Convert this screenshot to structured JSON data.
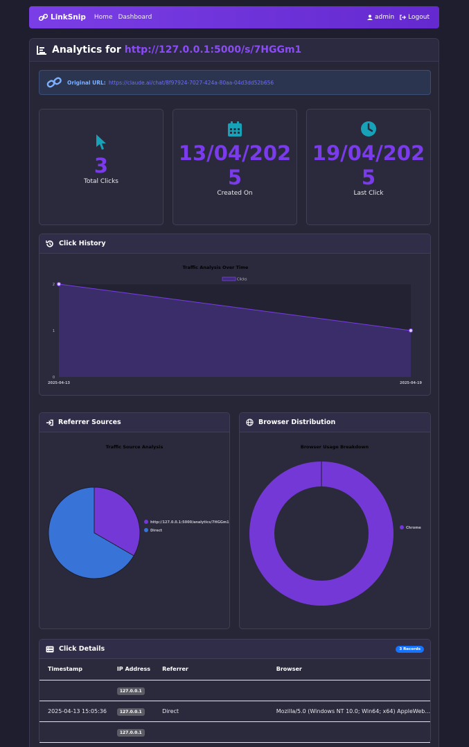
{
  "nav": {
    "brand": "LinkSnip",
    "links": [
      "Home",
      "Dashboard"
    ],
    "user": "admin",
    "logout": "Logout"
  },
  "header": {
    "prefix": "Analytics for",
    "short_url": "http://127.0.0.1:5000/s/7HGGm1"
  },
  "alert": {
    "label": "Original URL:",
    "url": "https://claude.ai/chat/8f97924-7027-424a-80aa-04d3dd52b656"
  },
  "stats": {
    "total_clicks": "3",
    "total_clicks_label": "Total Clicks",
    "created_line1": "13/04/202",
    "created_line2": "5",
    "created_label": "Created On",
    "last_line1": "19/04/202",
    "last_line2": "5",
    "last_label": "Last Click"
  },
  "click_history": {
    "title": "Click History",
    "chart_data": {
      "type": "area",
      "title": "Traffic Analysis Over Time",
      "x": [
        "2025-04-13",
        "2025-04-19"
      ],
      "series": [
        {
          "name": "Clicks",
          "values": [
            2,
            1
          ]
        }
      ],
      "ylim": [
        0,
        2
      ],
      "yticks": [
        "0",
        "1",
        "2"
      ],
      "legend": "top",
      "color": "#7a3bea"
    }
  },
  "referrer": {
    "title": "Referrer Sources",
    "chart_data": {
      "type": "pie",
      "title": "Traffic Source Analysis",
      "categories": [
        "http://127.0.0.1:5000/analytics/7HGGm1",
        "Direct"
      ],
      "values": [
        1,
        2
      ],
      "colors": [
        "#7438d6",
        "#3874d8"
      ],
      "legend": "right"
    }
  },
  "browser": {
    "title": "Browser Distribution",
    "chart_data": {
      "type": "pie",
      "title": "Browser Usage Breakdown",
      "categories": [
        "Chrome"
      ],
      "values": [
        3
      ],
      "colors": [
        "#7438d6"
      ],
      "legend": "right"
    }
  },
  "details": {
    "title": "Click Details",
    "badge": "3 Records",
    "columns": [
      "Timestamp",
      "IP Address",
      "Referrer",
      "Browser"
    ],
    "rows": [
      {
        "timestamp": "",
        "ip": "127.0.0.1",
        "referrer": "",
        "browser": ""
      },
      {
        "timestamp": "2025-04-13 15:05:36",
        "ip": "127.0.0.1",
        "referrer": "Direct",
        "browser": "Mozilla/5.0 (Windows NT 10.0; Win64; x64) AppleWeb..."
      },
      {
        "timestamp": "",
        "ip": "127.0.0.1",
        "referrer": "",
        "browser": ""
      }
    ]
  }
}
